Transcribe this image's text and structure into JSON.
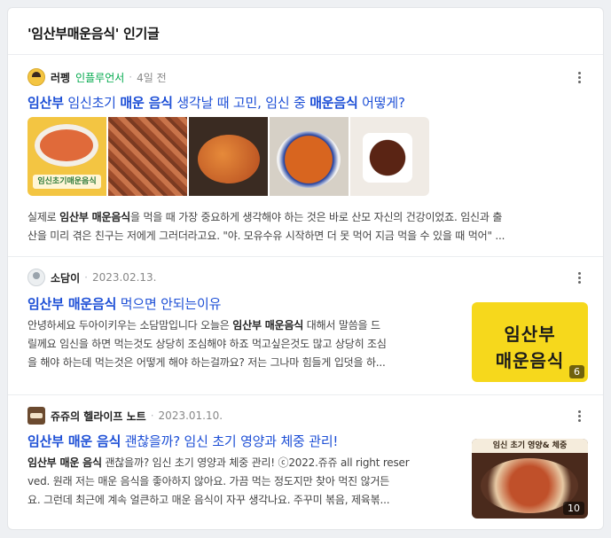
{
  "section": {
    "title": "'임산부매운음식' 인기글"
  },
  "posts": [
    {
      "author": "러펭",
      "badge": "인플루언서",
      "date": "4일 전",
      "title": {
        "b1": "임산부",
        "t1": " 임신초기 ",
        "b2": "매운 음식",
        "t2": " 생각날 때 고민, 임신 중 ",
        "b3": "매운음식",
        "t3": " 어떻게?"
      },
      "thumb_label": "임신초기매운음식",
      "desc": {
        "a": "실제로 ",
        "b1": "임산부 매운음식",
        "c": "을 먹을 때 가장 중요하게 생각해야 하는 것은 바로 산모 자신의 건강이었죠. 임신과 출",
        "line2": "산을 미리 겪은 친구는 저에게 그러더라고요. \"야. 모유수유 시작하면 더 못 먹어 지금 먹을 수 있을 때 먹어\" ..."
      }
    },
    {
      "author": "소담이",
      "date": "2023.02.13.",
      "title": {
        "b1": "임산부 매운음식",
        "t1": " 먹으면 안되는이유"
      },
      "thumb_text_1": "임산부",
      "thumb_text_2": "매운음식",
      "thumb_count": "6",
      "desc": {
        "a": "안녕하세요 두아이키우는 소담맘입니다 오늘은 ",
        "b1": "임산부 매운음식",
        "c": " 대해서 말씀을 드",
        "line2": "릴께요 임신을 하면 먹는것도 상당히 조심해야 하죠 먹고싶은것도 많고 상당히 조심",
        "line3": "을 해야 하는데 먹는것은 어떻게 해야 하는걸까요? 저는 그나마 힘들게 입덧을 하..."
      }
    },
    {
      "author": "쥬쥬의 헬라이프 노트",
      "date": "2023.01.10.",
      "title": {
        "b1": "임산부 매운 음식",
        "t1": " 괜찮을까? 임신 초기 영양과 체중 관리!"
      },
      "thumb_banner": "임신 초기 영양& 체중",
      "thumb_count": "10",
      "desc": {
        "b1": "임산부 매운 음식",
        "c": " 괜찮을까? 임신 초기 영양과 체중 관리! ⓒ2022.쥬쥬 all right reser",
        "line2": "ved. 원래 저는 매운 음식을 좋아하지 않아요. 가끔 먹는 정도지만 찾아 먹진 않거든",
        "line3": "요. 그런데 최근에 계속 얼큰하고 매운 음식이 자꾸 생각나요. 주꾸미 볶음, 제육볶..."
      }
    }
  ]
}
